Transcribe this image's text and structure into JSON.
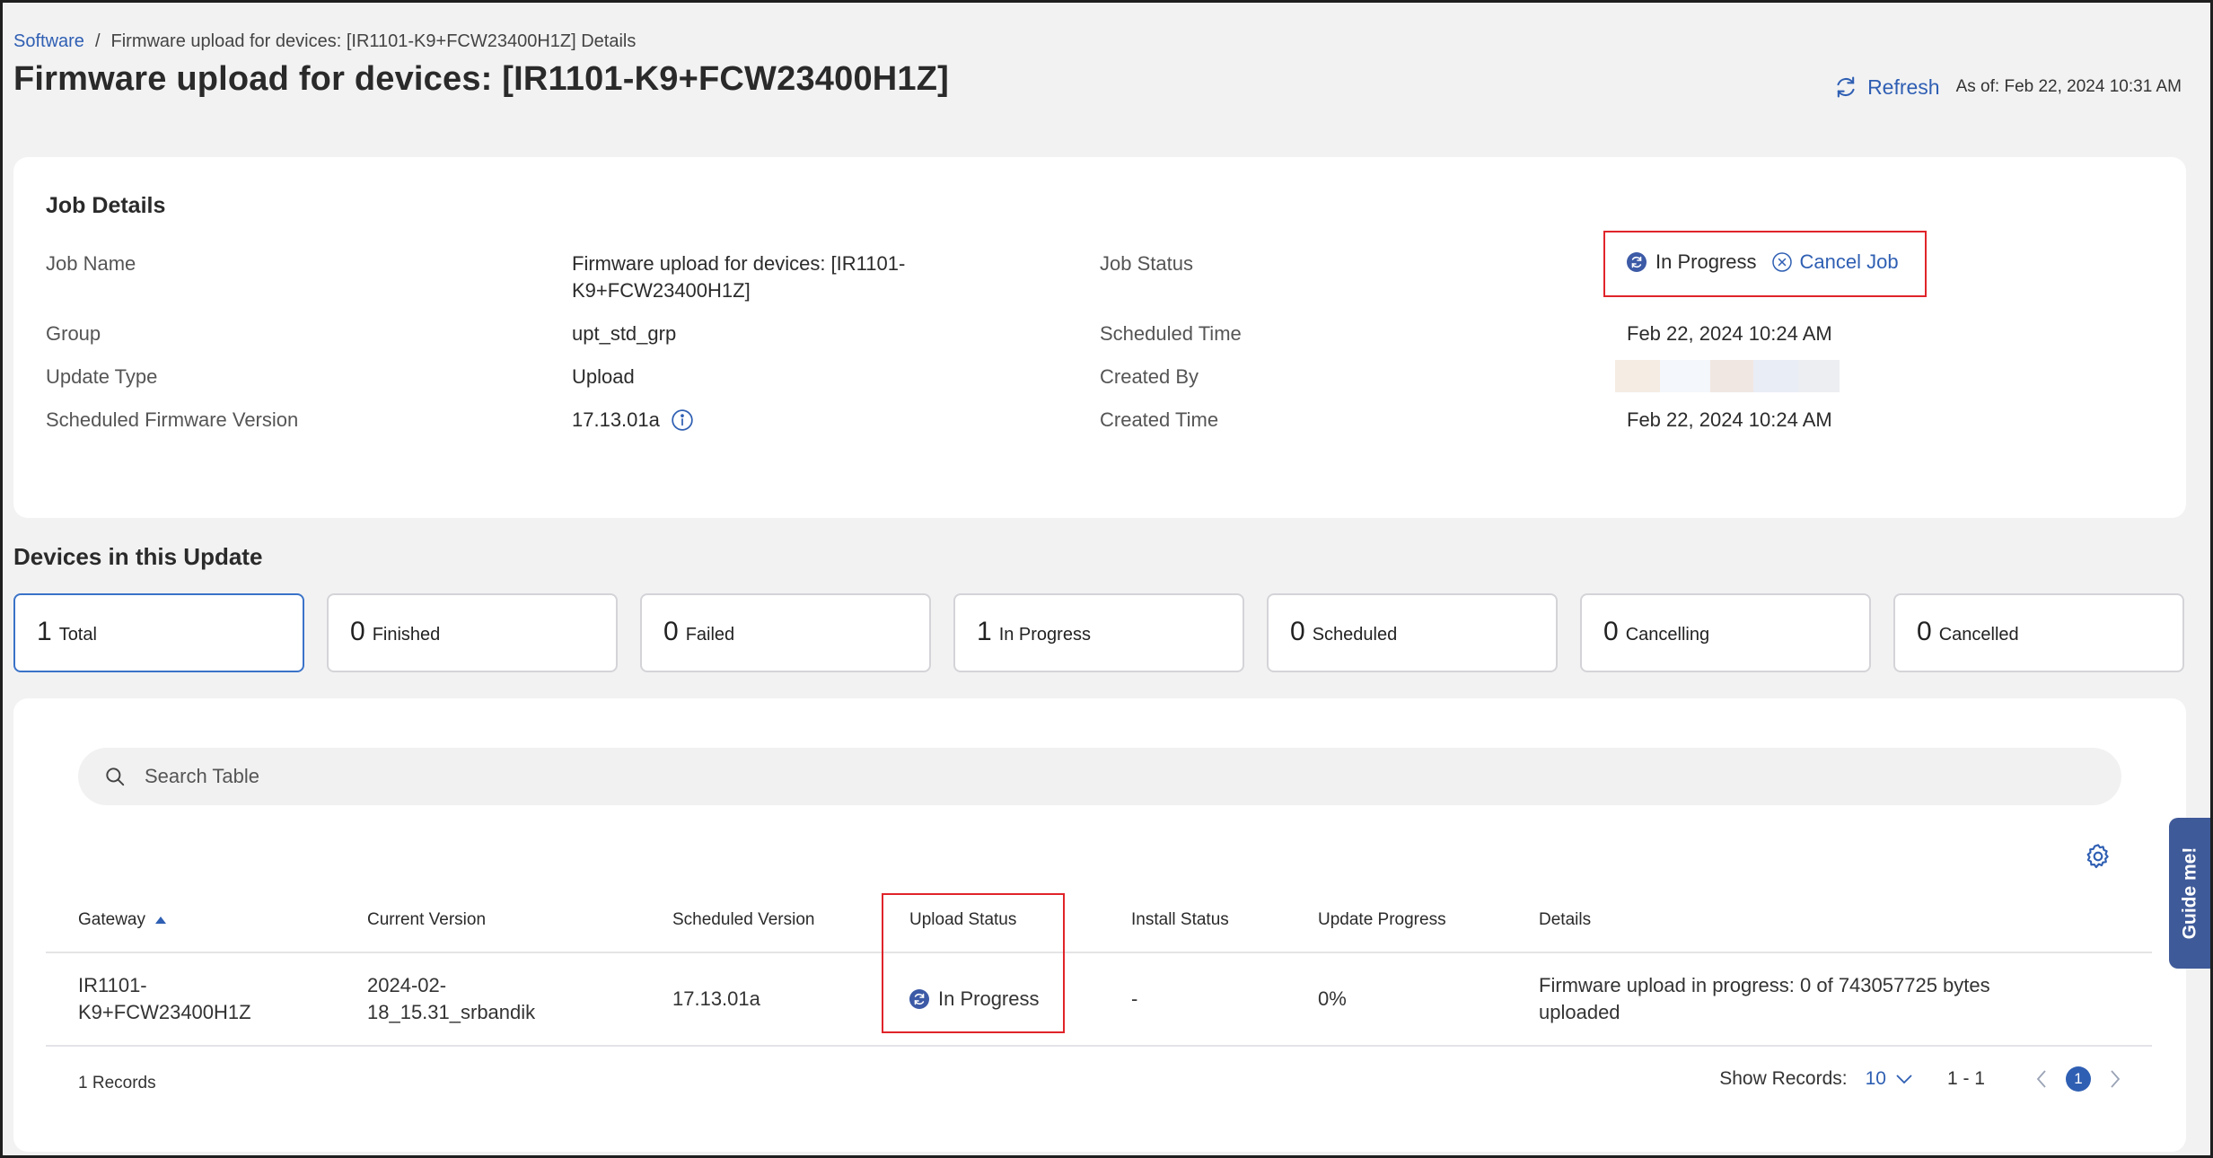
{
  "breadcrumb": {
    "root": "Software",
    "separator": "/",
    "current": "Firmware upload for devices: [IR1101-K9+FCW23400H1Z] Details"
  },
  "page_title": "Firmware upload for devices: [IR1101-K9+FCW23400H1Z]",
  "refresh": {
    "label": "Refresh",
    "as_of": "As of: Feb 22, 2024 10:31 AM"
  },
  "job_details": {
    "title": "Job Details",
    "job_name_label": "Job Name",
    "job_name_line1": "Firmware upload for devices: [IR1101-",
    "job_name_line2": "K9+FCW23400H1Z]",
    "group_label": "Group",
    "group_value": "upt_std_grp",
    "update_type_label": "Update Type",
    "update_type_value": "Upload",
    "sched_fw_label": "Scheduled Firmware Version",
    "sched_fw_value": "17.13.01a",
    "job_status_label": "Job Status",
    "job_status_value": "In Progress",
    "cancel_label": "Cancel Job",
    "scheduled_time_label": "Scheduled Time",
    "scheduled_time_value": "Feb 22, 2024 10:24 AM",
    "created_by_label": "Created By",
    "created_time_label": "Created Time",
    "created_time_value": "Feb 22, 2024 10:24 AM"
  },
  "devices": {
    "title": "Devices in this Update",
    "stats": [
      {
        "num": "1",
        "label": "Total"
      },
      {
        "num": "0",
        "label": "Finished"
      },
      {
        "num": "0",
        "label": "Failed"
      },
      {
        "num": "1",
        "label": "In Progress"
      },
      {
        "num": "0",
        "label": "Scheduled"
      },
      {
        "num": "0",
        "label": "Cancelling"
      },
      {
        "num": "0",
        "label": "Cancelled"
      }
    ]
  },
  "table": {
    "search_placeholder": "Search Table",
    "headers": [
      "Gateway",
      "Current Version",
      "Scheduled Version",
      "Upload Status",
      "Install Status",
      "Update Progress",
      "Details"
    ],
    "row": {
      "gateway_line1": "IR1101-",
      "gateway_line2": "K9+FCW23400H1Z",
      "current_line1": "2024-02-",
      "current_line2": "18_15.31_srbandik",
      "scheduled": "17.13.01a",
      "upload_status": "In Progress",
      "install_status": "-",
      "progress": "0%",
      "details_line1": "Firmware upload in progress: 0 of 743057725 bytes",
      "details_line2": "uploaded"
    },
    "records": "1 Records",
    "show_records_label": "Show Records:",
    "show_records_value": "10",
    "range": "1 - 1",
    "page": "1"
  },
  "guide": {
    "label": "Guide me!"
  },
  "colors": {
    "accent": "#2f5fb3",
    "highlight": "#e0242a",
    "status": "#3c5aa6"
  }
}
